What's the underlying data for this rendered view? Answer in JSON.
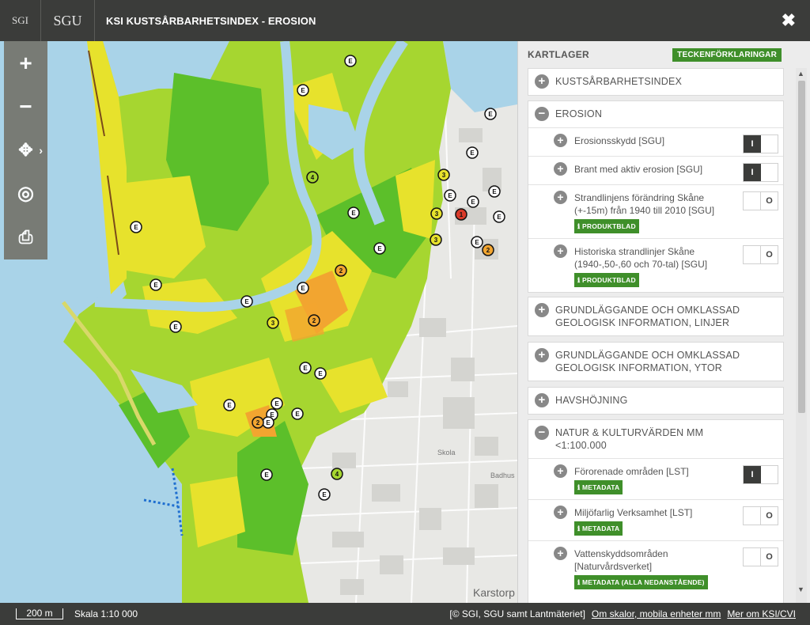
{
  "header": {
    "logo_sgi": "SGI",
    "logo_sgu": "SGU",
    "title": "KSI KUSTSÅRBARHETSINDEX - EROSION",
    "close": "✖"
  },
  "toolbar": {
    "zoom_in": "+",
    "zoom_out": "−",
    "pan": "✥",
    "locate": "◎",
    "print": "⎙"
  },
  "map": {
    "labels": [
      "Karstorp",
      "Badhus",
      "Skola"
    ],
    "markers_e": "E",
    "markers_numbers": [
      "1",
      "2",
      "3",
      "4"
    ],
    "colors": {
      "sea": "#a9d3e8",
      "very_low": "#5cbf2a",
      "low": "#a6d630",
      "medium": "#e7e22c",
      "high": "#f2a530",
      "very_high": "#d93b2a"
    }
  },
  "panel": {
    "title": "KARTLAGER",
    "legend_button": "TECKENFÖRKLARINGAR",
    "groups": [
      {
        "label": "KUSTSÅRBARHETSINDEX",
        "expanded": false
      },
      {
        "label": "EROSION",
        "expanded": true
      },
      {
        "label": "GRUNDLÄGGANDE OCH OMKLASSAD GEOLOGISK INFORMATION, LINJER",
        "expanded": false
      },
      {
        "label": "GRUNDLÄGGANDE OCH OMKLASSAD GEOLOGISK INFORMATION, YTOR",
        "expanded": false
      },
      {
        "label": "HAVSHÖJNING",
        "expanded": false
      },
      {
        "label": "NATUR & KULTURVÄRDEN MM <1:100.000",
        "expanded": true
      }
    ],
    "erosion_layers": [
      {
        "label": "Erosionsskydd [SGU]",
        "state": "I"
      },
      {
        "label": "Brant med aktiv erosion [SGU]",
        "state": "I"
      },
      {
        "label": "Strandlinjens förändring Skåne (+-15m) från 1940 till 2010 [SGU]",
        "badge": "PRODUKTBLAD",
        "state": "O"
      },
      {
        "label": "Historiska strandlinjer Skåne (1940-,50-,60 och 70-tal) [SGU]",
        "badge": "PRODUKTBLAD",
        "state": "O"
      }
    ],
    "natur_layers": [
      {
        "label": "Förorenade områden [LST]",
        "badge": "METADATA",
        "state": "I"
      },
      {
        "label": "Miljöfarlig Verksamhet [LST]",
        "badge": "METADATA",
        "state": "O"
      },
      {
        "label": "Vattenskyddsområden [Naturvårdsverket]",
        "badge": "METADATA (ALLA NEDANSTÅENDE)",
        "state": "O"
      }
    ],
    "badge_icon": "ℹ"
  },
  "footer": {
    "scalebar": "200 m",
    "scale": "Skala 1:10 000",
    "attribution": "[© SGI, SGU samt Lantmäteriet]",
    "link_mobile": "Om skalor, mobila enheter mm",
    "link_more": "Mer om KSI/CVI"
  }
}
